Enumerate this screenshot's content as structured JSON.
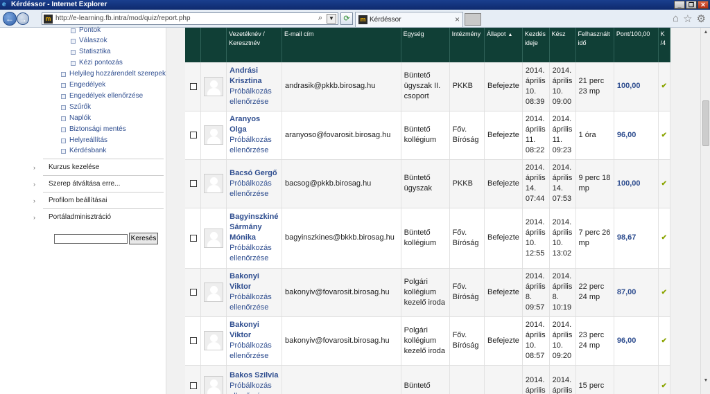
{
  "window": {
    "title": "Kérdéssor - Internet Explorer"
  },
  "browser": {
    "url": "http://e-learning.fb.intra/mod/quiz/report.php",
    "tab_title": "Kérdéssor"
  },
  "sidebar": {
    "sub_items": [
      "Pontok",
      "Válaszok",
      "Statisztika",
      "Kézi pontozás"
    ],
    "items": [
      "Helyileg hozzárendelt szerepek",
      "Engedélyek",
      "Engedélyek ellenőrzése",
      "Szűrők",
      "Naplók",
      "Biztonsági mentés",
      "Helyreállítás",
      "Kérdésbank"
    ],
    "blocks": [
      "Kurzus kezelése",
      "Szerep átváltása erre...",
      "Profilom beállításai",
      "Portáladminisztráció"
    ],
    "search_button": "Keresés"
  },
  "table": {
    "headers": {
      "name": "Vezetéknév / Keresztnév",
      "email": "E-mail cím",
      "unit": "Egység",
      "institution": "Intézmény",
      "status": "Állapot",
      "started": "Kezdés ideje",
      "done": "Kész",
      "time_used": "Felhasznált idő",
      "grade": "Pont/100,00",
      "next": "K /4"
    },
    "review_label": "Próbálkozás ellenőrzése",
    "rows": [
      {
        "name": "Andrási Krisztina",
        "email": "andrasik@pkkb.birosag.hu",
        "unit": "Büntető ügyszak II. csoport",
        "institution": "PKKB",
        "status": "Befejezte",
        "started": "2014. április 10. 08:39",
        "done": "2014. április 10. 09:00",
        "time_used": "21 perc 23 mp",
        "grade": "100,00"
      },
      {
        "name": "Aranyos Olga",
        "email": "aranyoso@fovarosit.birosag.hu",
        "unit": "Büntető kollégium",
        "institution": "Főv. Bíróság",
        "status": "Befejezte",
        "started": "2014. április 11. 08:22",
        "done": "2014. április 11. 09:23",
        "time_used": "1 óra",
        "grade": "96,00"
      },
      {
        "name": "Bacsó Gergő",
        "email": "bacsog@pkkb.birosag.hu",
        "unit": "Büntető ügyszak",
        "institution": "PKKB",
        "status": "Befejezte",
        "started": "2014. április 14. 07:44",
        "done": "2014. április 14. 07:53",
        "time_used": "9 perc 18 mp",
        "grade": "100,00"
      },
      {
        "name": "Bagyinszkiné Sármány Mónika",
        "email": "bagyinszkines@bkkb.birosag.hu",
        "unit": "Büntető kollégium",
        "institution": "Főv. Bíróság",
        "status": "Befejezte",
        "started": "2014. április 10. 12:55",
        "done": "2014. április 10. 13:02",
        "time_used": "7 perc 26 mp",
        "grade": "98,67"
      },
      {
        "name": "Bakonyi Viktor",
        "email": "bakonyiv@fovarosit.birosag.hu",
        "unit": "Polgári kollégium kezelő iroda",
        "institution": "Főv. Bíróság",
        "status": "Befejezte",
        "started": "2014. április 8. 09:57",
        "done": "2014. április 8. 10:19",
        "time_used": "22 perc 24 mp",
        "grade": "87,00"
      },
      {
        "name": "Bakonyi Viktor",
        "email": "bakonyiv@fovarosit.birosag.hu",
        "unit": "Polgári kollégium kezelő iroda",
        "institution": "Főv. Bíróság",
        "status": "Befejezte",
        "started": "2014. április 10. 08:57",
        "done": "2014. április 10. 09:20",
        "time_used": "23 perc 24 mp",
        "grade": "96,00"
      },
      {
        "name": "Bakos Szilvia",
        "email": "",
        "unit": "Büntető",
        "institution": "",
        "status": "",
        "started": "2014. április",
        "done": "2014. április",
        "time_used": "15 perc",
        "grade": ""
      }
    ]
  }
}
